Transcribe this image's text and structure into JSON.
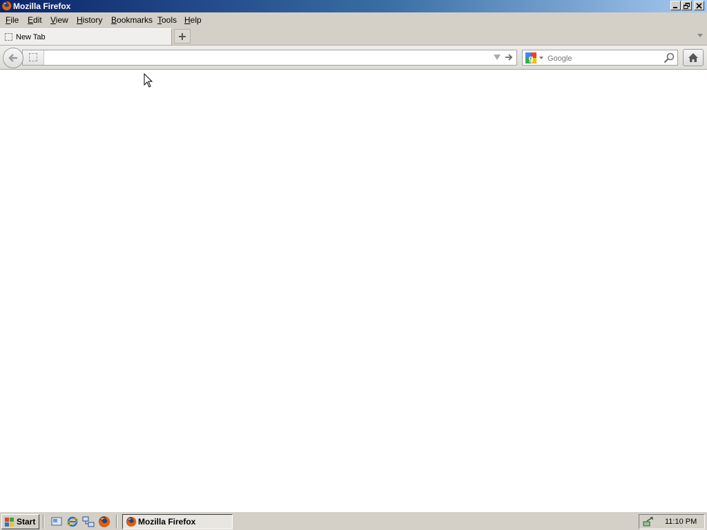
{
  "window": {
    "title": "Mozilla Firefox"
  },
  "menubar": {
    "items": [
      {
        "label_u": "F",
        "label_rest": "ile"
      },
      {
        "label_u": "E",
        "label_rest": "dit"
      },
      {
        "label_u": "V",
        "label_rest": "iew"
      },
      {
        "label_u": "H",
        "label_rest": "istory"
      },
      {
        "label_u": "B",
        "label_rest": "ookmarks"
      },
      {
        "label_u": "T",
        "label_rest": "ools"
      },
      {
        "label_u": "H",
        "label_rest": "elp"
      }
    ]
  },
  "tabs": [
    {
      "label": "New Tab"
    }
  ],
  "urlbar": {
    "value": "",
    "placeholder": ""
  },
  "searchbar": {
    "engine": "google-icon",
    "placeholder": "Google"
  },
  "taskbar": {
    "start_label": "Start",
    "task_label": "Mozilla Firefox",
    "clock": "11:10 PM"
  },
  "colors": {
    "titlebar_start": "#0a246a",
    "titlebar_end": "#a6caf0",
    "chrome_bg": "#d4d0c8"
  }
}
